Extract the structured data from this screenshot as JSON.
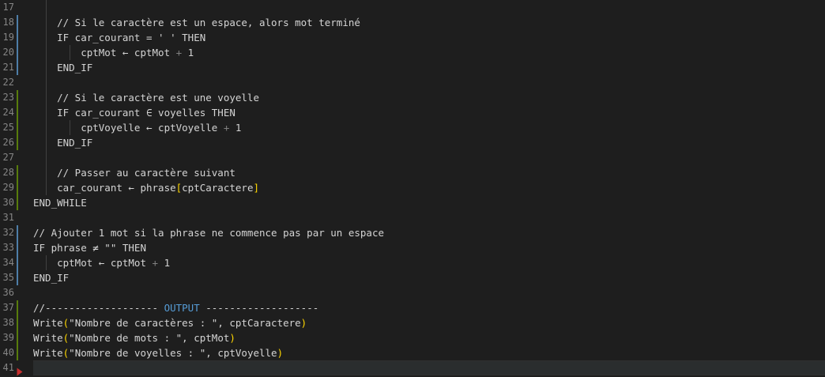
{
  "colors": {
    "background": "#1e1e1e",
    "line_number": "#858585",
    "modified_gutter": "#4e7ea8",
    "added_gutter": "#587c0c",
    "keyword": "#569cd6",
    "bracket_gold": "#ffd700"
  },
  "editor": {
    "current_line": 41,
    "lines": [
      {
        "num": "17",
        "mark": "none",
        "guides": 1,
        "text": ""
      },
      {
        "num": "18",
        "mark": "modified",
        "guides": 1,
        "text": "    // Si le caractère est un espace, alors mot terminé"
      },
      {
        "num": "19",
        "mark": "modified",
        "guides": 1,
        "text": "    IF car_courant = ' ' THEN"
      },
      {
        "num": "20",
        "mark": "modified",
        "guides": 2,
        "text": "        cptMot ← cptMot + 1"
      },
      {
        "num": "21",
        "mark": "modified",
        "guides": 1,
        "text": "    END_IF"
      },
      {
        "num": "22",
        "mark": "none",
        "guides": 1,
        "text": ""
      },
      {
        "num": "23",
        "mark": "added",
        "guides": 1,
        "text": "    // Si le caractère est une voyelle"
      },
      {
        "num": "24",
        "mark": "added",
        "guides": 1,
        "text": "    IF car_courant ∈ voyelles THEN"
      },
      {
        "num": "25",
        "mark": "added",
        "guides": 2,
        "text": "        cptVoyelle ← cptVoyelle + 1"
      },
      {
        "num": "26",
        "mark": "added",
        "guides": 1,
        "text": "    END_IF"
      },
      {
        "num": "27",
        "mark": "none",
        "guides": 1,
        "text": ""
      },
      {
        "num": "28",
        "mark": "added",
        "guides": 1,
        "text": "    // Passer au caractère suivant"
      },
      {
        "num": "29",
        "mark": "added",
        "guides": 1,
        "text": "    car_courant ← phrase[cptCaractere]"
      },
      {
        "num": "30",
        "mark": "added",
        "guides": 0,
        "text": "END_WHILE"
      },
      {
        "num": "31",
        "mark": "none",
        "guides": 0,
        "text": ""
      },
      {
        "num": "32",
        "mark": "modified",
        "guides": 0,
        "text": "// Ajouter 1 mot si la phrase ne commence pas par un espace"
      },
      {
        "num": "33",
        "mark": "modified",
        "guides": 0,
        "text": "IF phrase ≠ \"\" THEN"
      },
      {
        "num": "34",
        "mark": "modified",
        "guides": 1,
        "text": "    cptMot ← cptMot + 1"
      },
      {
        "num": "35",
        "mark": "modified",
        "guides": 0,
        "text": "END_IF"
      },
      {
        "num": "36",
        "mark": "none",
        "guides": 0,
        "text": ""
      },
      {
        "num": "37",
        "mark": "added",
        "guides": 0,
        "text": "//------------------- OUTPUT -------------------"
      },
      {
        "num": "38",
        "mark": "added",
        "guides": 0,
        "text": "Write(\"Nombre de caractères : \", cptCaractere)"
      },
      {
        "num": "39",
        "mark": "added",
        "guides": 0,
        "text": "Write(\"Nombre de mots : \", cptMot)"
      },
      {
        "num": "40",
        "mark": "added",
        "guides": 0,
        "text": "Write(\"Nombre de voyelles : \", cptVoyelle)"
      },
      {
        "num": "41",
        "mark": "none",
        "guides": 0,
        "text": ""
      }
    ]
  }
}
